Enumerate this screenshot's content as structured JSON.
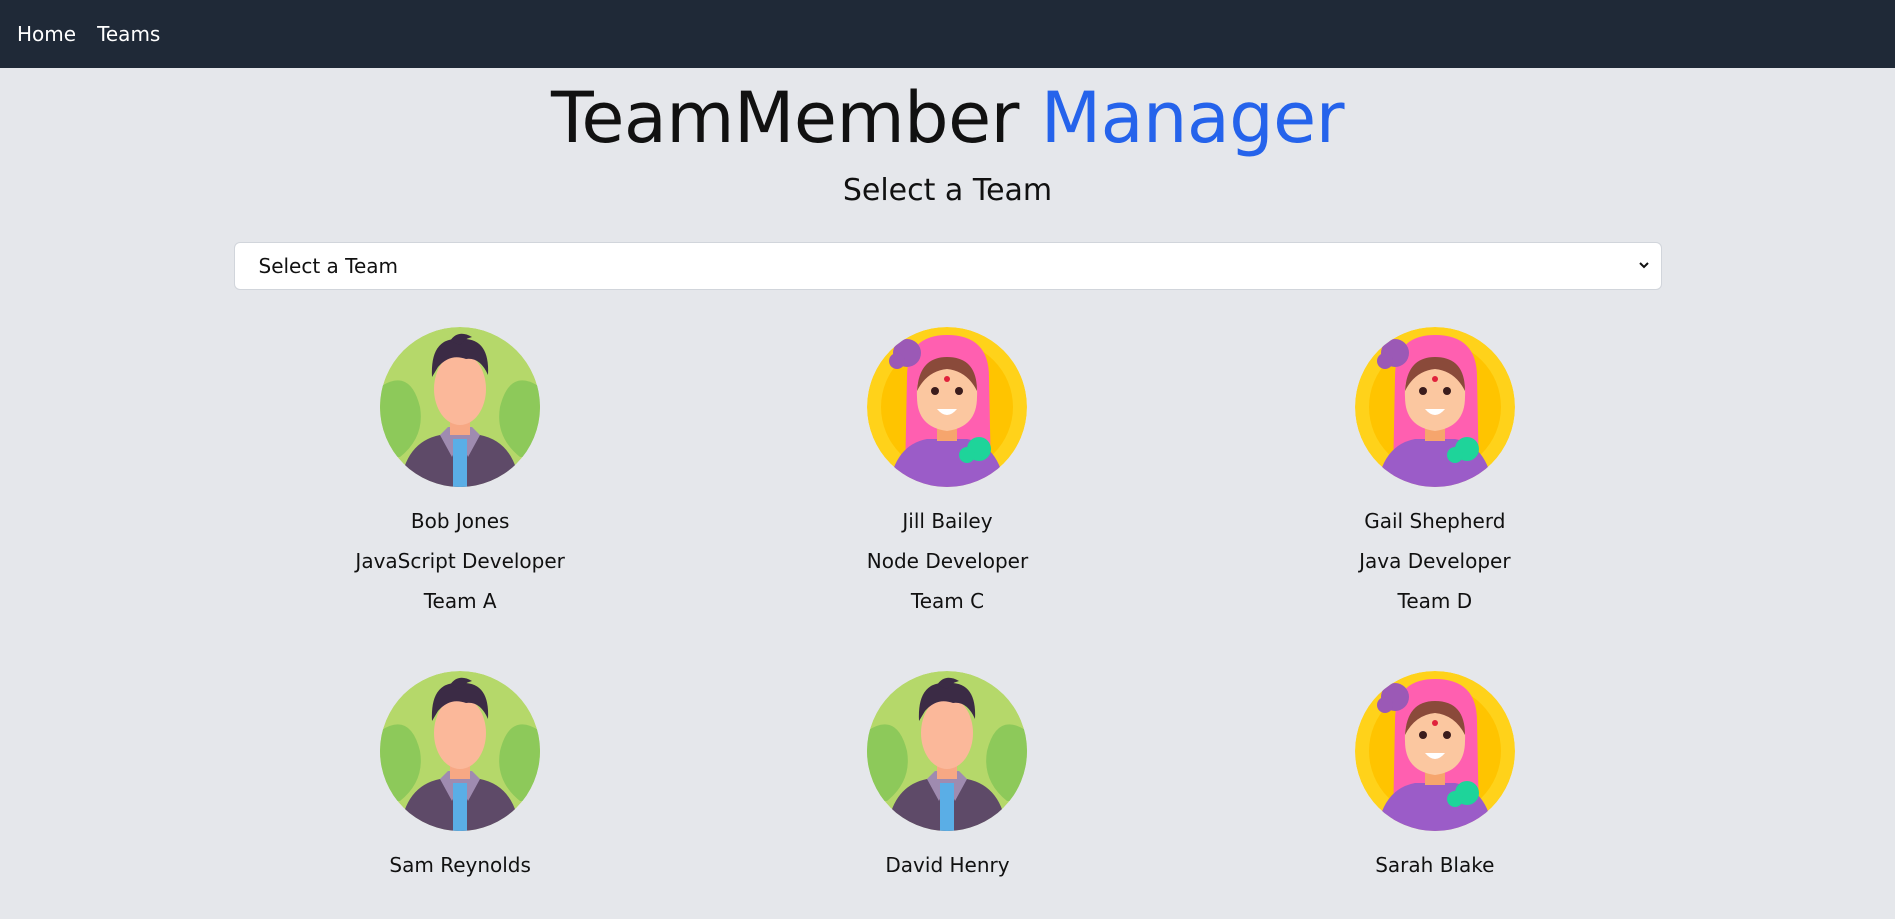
{
  "nav": {
    "items": [
      {
        "label": "Home"
      },
      {
        "label": "Teams"
      }
    ]
  },
  "header": {
    "title_main": "TeamMember",
    "title_accent": "Manager",
    "subtitle": "Select a Team"
  },
  "team_select": {
    "selected": "Select a Team",
    "options": [
      "Select a Team"
    ]
  },
  "colors": {
    "nav_bg": "#1f2937",
    "accent": "#2563eb",
    "page_bg": "#e5e7eb"
  },
  "members": [
    {
      "name": "Bob Jones",
      "role": "JavaScript Developer",
      "team": "Team A",
      "avatar": "male-avatar-icon"
    },
    {
      "name": "Jill Bailey",
      "role": "Node Developer",
      "team": "Team C",
      "avatar": "female-avatar-icon"
    },
    {
      "name": "Gail Shepherd",
      "role": "Java Developer",
      "team": "Team D",
      "avatar": "female-avatar-icon"
    },
    {
      "name": "Sam Reynolds",
      "role": "",
      "team": "",
      "avatar": "male-avatar-icon"
    },
    {
      "name": "David Henry",
      "role": "",
      "team": "",
      "avatar": "male-avatar-icon"
    },
    {
      "name": "Sarah Blake",
      "role": "",
      "team": "",
      "avatar": "female-avatar-icon"
    }
  ]
}
